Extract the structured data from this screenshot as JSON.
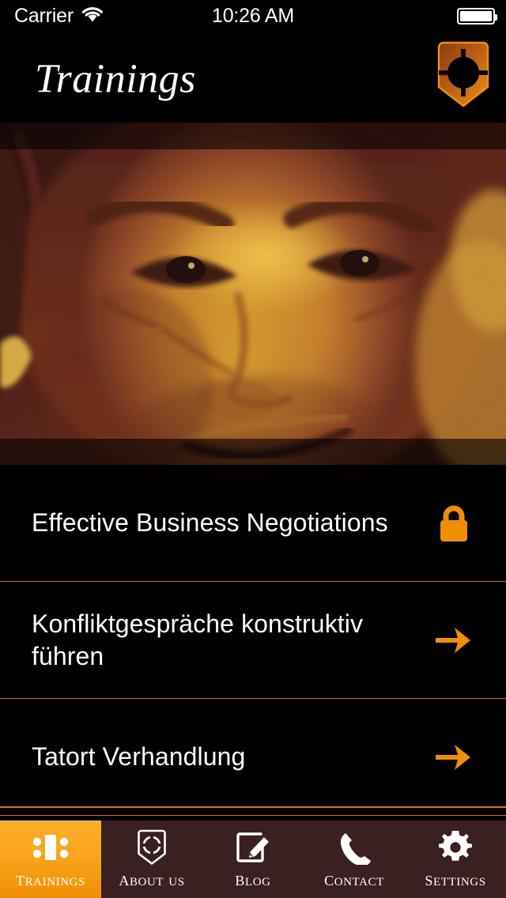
{
  "status_bar": {
    "carrier": "Carrier",
    "wifi_icon": "wifi-icon",
    "time": "10:26 AM",
    "battery_icon": "battery-full-icon"
  },
  "header": {
    "title": "Trainings",
    "logo_icon": "shield-logo-icon"
  },
  "hero": {
    "image_name": "duotone-portrait-smiling-man",
    "alt": "Close-up portrait of a smiling man, sepia-orange duotone"
  },
  "list": {
    "rows": [
      {
        "label": "Effective Business Negotiations",
        "accessory": "lock-icon",
        "locked": true
      },
      {
        "label": "Konfliktgespräche konstruktiv führen",
        "accessory": "arrow-right-icon",
        "locked": false
      },
      {
        "label": "Tatort Verhandlung",
        "accessory": "arrow-right-icon",
        "locked": false
      }
    ]
  },
  "tab_bar": {
    "active_index": 0,
    "items": [
      {
        "label": "Trainings",
        "icon": "meeting-table-icon"
      },
      {
        "label": "About Us",
        "icon": "shield-logo-icon"
      },
      {
        "label": "Blog",
        "icon": "compose-pencil-icon"
      },
      {
        "label": "Contact",
        "icon": "phone-icon"
      },
      {
        "label": "Settings",
        "icon": "gear-icon"
      }
    ]
  },
  "colors": {
    "background": "#000000",
    "accent_orange": "#ef8f06",
    "separator_orange": "#d2761a",
    "tabbar_background": "#3a2020",
    "active_tab_gradient_start": "#fcae2c",
    "active_tab_gradient_end": "#ef8f06",
    "text_primary": "#ffffff"
  }
}
